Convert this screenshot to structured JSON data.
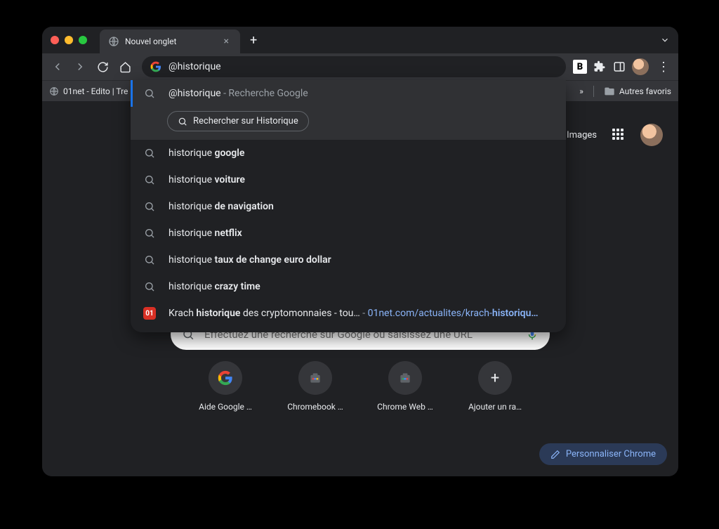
{
  "titlebar": {
    "tab_title": "Nouvel onglet"
  },
  "omnibox": {
    "value": "@historique"
  },
  "toolbar_icons": {
    "b_badge": "B"
  },
  "bookmarks": {
    "item": "01net - Edito | Tre",
    "other": "Autres favoris"
  },
  "suggestions": {
    "first_query": "@historique",
    "first_desc": "Recherche Google",
    "chip_label": "Rechercher sur Historique",
    "items": [
      {
        "prefix": "historique ",
        "bold": "google"
      },
      {
        "prefix": "historique ",
        "bold": "voiture"
      },
      {
        "prefix": "historique ",
        "bold": "de navigation"
      },
      {
        "prefix": "historique ",
        "bold": "netflix"
      },
      {
        "prefix": "historique ",
        "bold": "taux de change euro dollar"
      },
      {
        "prefix": "historique ",
        "bold": "crazy time"
      }
    ],
    "history_badge": "01",
    "history_text_a": "Krach ",
    "history_text_b": "historique",
    "history_text_c": " des cryptomonnaies - tou…",
    "history_sep": " - ",
    "history_url_a": "01net.com/actualites/krach-",
    "history_url_b": "historiqu…"
  },
  "ntp": {
    "images_link": "Images",
    "search_placeholder": "Effectuez une recherche sur Google ou saisissez une URL",
    "shortcuts": [
      {
        "label": "Aide Google …",
        "icon": "g"
      },
      {
        "label": "Chromebook …",
        "icon": "bag"
      },
      {
        "label": "Chrome Web …",
        "icon": "bag"
      },
      {
        "label": "Ajouter un ra…",
        "icon": "plus"
      }
    ],
    "customize": "Personnaliser Chrome"
  }
}
